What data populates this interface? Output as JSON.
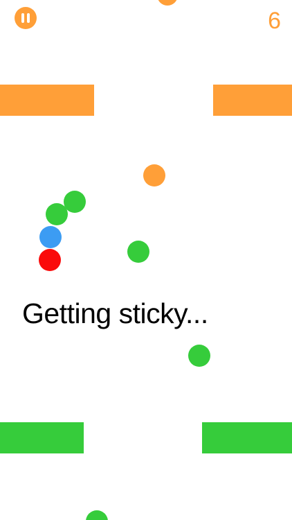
{
  "hud": {
    "score": "6",
    "pause_icon": "pause-icon"
  },
  "message": "Getting sticky...",
  "colors": {
    "orange": "#ff9f38",
    "green": "#36cc3b",
    "blue": "#3c9cf3",
    "red": "#fa0a0a",
    "background": "#ffffff"
  }
}
